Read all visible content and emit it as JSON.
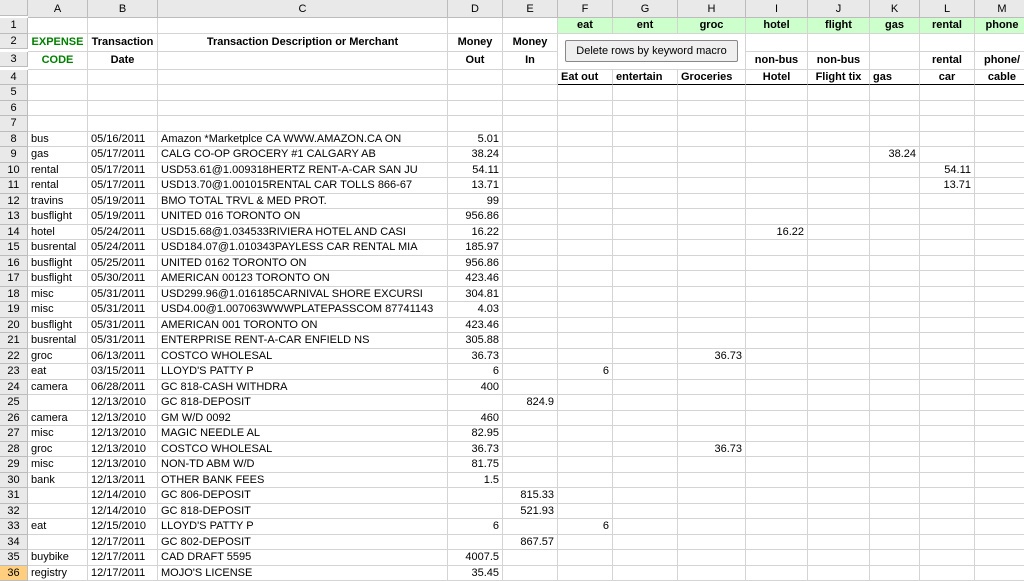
{
  "colHeaders": [
    "A",
    "B",
    "C",
    "D",
    "E",
    "F",
    "G",
    "H",
    "I",
    "J",
    "K",
    "L",
    "M"
  ],
  "topGreen": {
    "F": "eat",
    "G": "ent",
    "H": "groc",
    "I": "hotel",
    "J": "flight",
    "K": "gas",
    "L": "rental",
    "M": "phone"
  },
  "hdr": {
    "A": "EXPENSE CODE",
    "B": "Transaction Date",
    "C": "Transaction Description or Merchant",
    "D": "Money Out",
    "E": "Money In",
    "I2": "non-bus",
    "J2": "non-bus",
    "F": "Eat out",
    "G": "entertain",
    "H": "Groceries",
    "I": "Hotel",
    "J": "Flight tix",
    "K": "gas",
    "L": "rental car",
    "M": "phone/ cable"
  },
  "macroBtn": "Delete rows by keyword macro",
  "rows": [
    {
      "n": 8,
      "A": "bus",
      "B": "05/16/2011",
      "C": "Amazon *Marketplce CA  WWW.AMAZON.CA ON",
      "D": "5.01"
    },
    {
      "n": 9,
      "A": "gas",
      "B": "05/17/2011",
      "C": "CALG CO-OP GROCERY #1  CALGARY        AB",
      "D": "38.24",
      "K": "38.24"
    },
    {
      "n": 10,
      "A": "rental",
      "B": "05/17/2011",
      "C": "USD53.61@1.009318HERTZ RENT-A-CAR SAN JU",
      "D": "54.11",
      "L": "54.11"
    },
    {
      "n": 11,
      "A": "rental",
      "B": "05/17/2011",
      "C": "USD13.70@1.001015RENTAL CAR TOLLS 866-67",
      "D": "13.71",
      "L": "13.71"
    },
    {
      "n": 12,
      "A": "travins",
      "B": "05/19/2011",
      "C": "BMO TOTAL TRVL & MED PROT.",
      "D": "99"
    },
    {
      "n": 13,
      "A": "busflight",
      "B": "05/19/2011",
      "C": "UNITED   016 TORONTO        ON",
      "D": "956.86"
    },
    {
      "n": 14,
      "A": "hotel",
      "B": "05/24/2011",
      "C": "USD15.68@1.034533RIVIERA HOTEL AND CASI",
      "D": "16.22",
      "I": "16.22"
    },
    {
      "n": 15,
      "A": "busrental",
      "B": "05/24/2011",
      "C": "USD184.07@1.010343PAYLESS CAR RENTAL MIA",
      "D": "185.97"
    },
    {
      "n": 16,
      "A": "busflight",
      "B": "05/25/2011",
      "C": "UNITED   0162 TORONTO        ON",
      "D": "956.86"
    },
    {
      "n": 17,
      "A": "busflight",
      "B": "05/30/2011",
      "C": "AMERICAN 00123 TORONTO       ON",
      "D": "423.46"
    },
    {
      "n": 18,
      "A": "misc",
      "B": "05/31/2011",
      "C": "USD299.96@1.016185CARNIVAL SHORE EXCURSI",
      "D": "304.81"
    },
    {
      "n": 19,
      "A": "misc",
      "B": "05/31/2011",
      "C": "USD4.00@1.007063WWWPLATEPASSCOM 87741143",
      "D": "4.03"
    },
    {
      "n": 20,
      "A": "busflight",
      "B": "05/31/2011",
      "C": "AMERICAN 001 TORONTO       ON",
      "D": "423.46"
    },
    {
      "n": 21,
      "A": "busrental",
      "B": "05/31/2011",
      "C": "ENTERPRISE RENT-A-CAR  ENFIELD       NS",
      "D": "305.88"
    },
    {
      "n": 22,
      "A": "groc",
      "B": "06/13/2011",
      "C": "COSTCO WHOLESAL",
      "D": "36.73",
      "H": "36.73"
    },
    {
      "n": 23,
      "A": "eat",
      "B": "03/15/2011",
      "C": "LLOYD'S PATTY P",
      "D": "6",
      "F": "6"
    },
    {
      "n": 24,
      "A": "camera",
      "B": "06/28/2011",
      "C": "GC 818-CASH WITHDRA",
      "D": "400"
    },
    {
      "n": 25,
      "B": "12/13/2010",
      "C": "GC 818-DEPOSIT",
      "E": "824.9"
    },
    {
      "n": 26,
      "A": "camera",
      "B": "12/13/2010",
      "C": "GM W/D      0092",
      "D": "460"
    },
    {
      "n": 27,
      "A": "misc",
      "B": "12/13/2010",
      "C": "MAGIC NEEDLE AL",
      "D": "82.95"
    },
    {
      "n": 28,
      "A": "groc",
      "B": "12/13/2010",
      "C": "COSTCO WHOLESAL",
      "D": "36.73",
      "H": "36.73"
    },
    {
      "n": 29,
      "A": "misc",
      "B": "12/13/2010",
      "C": "NON-TD ABM W/D",
      "D": "81.75"
    },
    {
      "n": 30,
      "A": "bank",
      "B": "12/13/2011",
      "C": "OTHER BANK FEES",
      "D": "1.5"
    },
    {
      "n": 31,
      "B": "12/14/2010",
      "C": "GC 806-DEPOSIT",
      "E": "815.33"
    },
    {
      "n": 32,
      "B": "12/14/2010",
      "C": "GC 818-DEPOSIT",
      "E": "521.93"
    },
    {
      "n": 33,
      "A": "eat",
      "B": "12/15/2010",
      "C": "LLOYD'S PATTY P",
      "D": "6",
      "F": "6"
    },
    {
      "n": 34,
      "B": "12/17/2011",
      "C": "GC 802-DEPOSIT",
      "E": "867.57"
    },
    {
      "n": 35,
      "A": "buybike",
      "B": "12/17/2011",
      "C": "CAD DRAFT 5595",
      "D": "4007.5"
    },
    {
      "n": 36,
      "A": "registry",
      "B": "12/17/2011",
      "C": "MOJO'S LICENSE",
      "D": "35.45"
    }
  ],
  "emptyRowsAfterHeader": [
    5,
    6,
    7
  ],
  "selectedRow": 36
}
